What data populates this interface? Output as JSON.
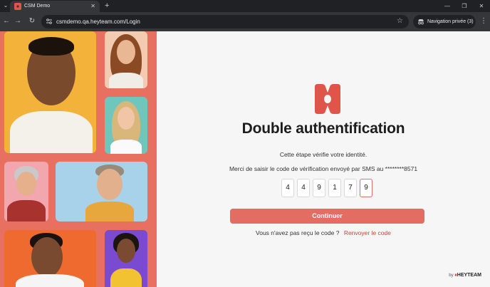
{
  "browser": {
    "tab_title": "CSM Demo",
    "tab_close": "✕",
    "new_tab": "+",
    "url": "csmdemo.qa.heyteam.com/Login",
    "incognito_label": "Navigation privée (3)",
    "window_minimize": "—",
    "window_restore": "❐",
    "window_close": "✕"
  },
  "page": {
    "heading": "Double authentification",
    "subtext": "Cette étape vérifie votre identité.",
    "instruction": "Merci de saisir le code de vérification envoyé par SMS au ********8571",
    "otp_digits": [
      "4",
      "4",
      "9",
      "1",
      "7",
      "9"
    ],
    "continue_label": "Continuer",
    "resend_prompt": "Vous n'avez pas reçu le code ?",
    "resend_link": "Renvoyer le code",
    "brand_by": "by",
    "brand_mark": "⏸",
    "brand_name": "HEYTEAM"
  },
  "colors": {
    "accent": "#e36c63",
    "left_panel": "#e87060",
    "logo": "#e0554a"
  },
  "icons": {
    "back": "arrow-left-icon",
    "forward": "arrow-right-icon",
    "reload": "reload-icon",
    "site_info": "tune-icon",
    "bookmark": "star-icon",
    "incognito": "incognito-icon",
    "menu": "kebab-menu-icon"
  }
}
